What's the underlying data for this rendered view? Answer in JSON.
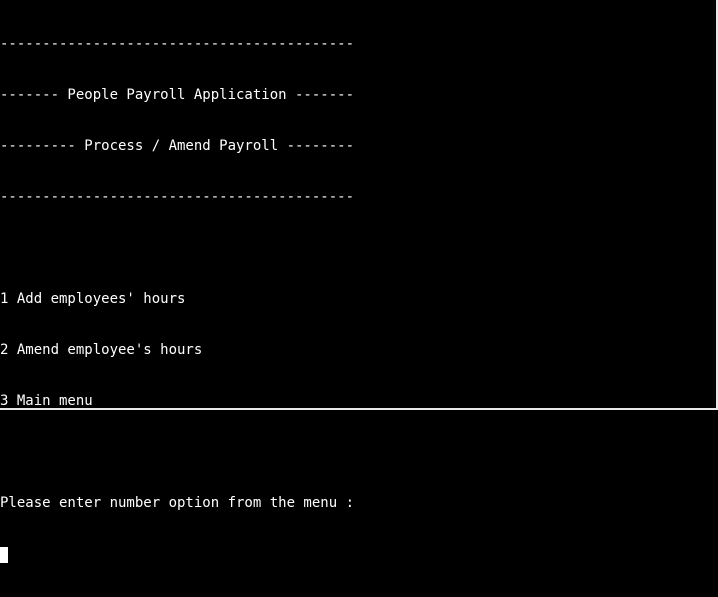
{
  "header": {
    "rule_top": "------------------------------------------",
    "title": "------- People Payroll Application -------",
    "subtitle": "--------- Process / Amend Payroll --------",
    "rule_bottom": "------------------------------------------"
  },
  "menu": {
    "items": [
      "1 Add employees' hours",
      "2 Amend employee's hours",
      "3 Main menu"
    ]
  },
  "prompt": {
    "text": "Please enter number option from the menu : "
  },
  "colors": {
    "background": "#000000",
    "foreground": "#ffffff"
  }
}
